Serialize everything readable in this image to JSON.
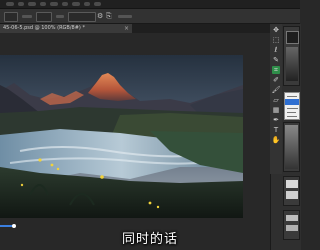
{
  "menubar": {
    "label": "Photoshop menu bar (blurred)"
  },
  "options_bar": {
    "item_a": "▭",
    "item_b": "⚙",
    "item_c": "⎘"
  },
  "document_tab": {
    "title": "45-06-5.psd @ 100% (RGB/8#) *",
    "close_label": "×"
  },
  "canvas": {
    "description_color_sky": "#3d4a5c",
    "accent_peak": "#d9784a"
  },
  "tools": [
    {
      "name": "move-tool",
      "glyph": "✥"
    },
    {
      "name": "marquee-tool",
      "glyph": "⬚"
    },
    {
      "name": "lasso-tool",
      "glyph": "ℓ"
    },
    {
      "name": "quick-select-tool",
      "glyph": "✎"
    },
    {
      "name": "crop-tool",
      "glyph": "⌗"
    },
    {
      "name": "eyedropper-tool",
      "glyph": "✐"
    },
    {
      "name": "brush-tool",
      "glyph": "🖌"
    },
    {
      "name": "eraser-tool",
      "glyph": "▱"
    },
    {
      "name": "gradient-tool",
      "glyph": "▦"
    },
    {
      "name": "pen-tool",
      "glyph": "✒"
    },
    {
      "name": "text-tool",
      "glyph": "T"
    },
    {
      "name": "hand-tool",
      "glyph": "✋"
    }
  ],
  "subtitle": {
    "text": "同时的话"
  },
  "colors": {
    "swatch_green": "#2f8f4a",
    "menu_highlight": "#2f6fd1",
    "timeline_blue": "#3b7fe0"
  }
}
